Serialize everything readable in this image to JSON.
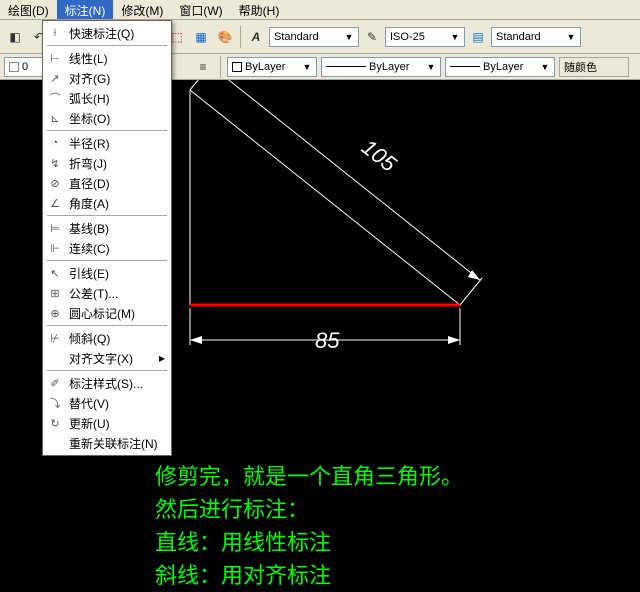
{
  "menu": {
    "draw": "绘图(D)",
    "dim": "标注(N)",
    "modify": "修改(M)",
    "window": "窗口(W)",
    "help": "帮助(H)"
  },
  "styles": {
    "text": "Standard",
    "dim": "ISO-25",
    "table": "Standard"
  },
  "layer": {
    "name": "0",
    "linetype": "ByLayer",
    "lineweight": "ByLayer",
    "plotstyle": "ByLayer",
    "color": "随颜色"
  },
  "dimmenu": {
    "quick": "快速标注(Q)",
    "linear": "线性(L)",
    "aligned": "对齐(G)",
    "arc": "弧长(H)",
    "ordinate": "坐标(O)",
    "radius": "半径(R)",
    "jogged": "折弯(J)",
    "diameter": "直径(D)",
    "angular": "角度(A)",
    "baseline": "基线(B)",
    "continue": "连续(C)",
    "leader": "引线(E)",
    "tolerance": "公差(T)...",
    "center": "圆心标记(M)",
    "oblique": "倾斜(Q)",
    "alignText": "对齐文字(X)",
    "style": "标注样式(S)...",
    "override": "替代(V)",
    "update": "更新(U)",
    "reassoc": "重新关联标注(N)"
  },
  "dims": {
    "hyp": "105",
    "base": "85"
  },
  "annot": {
    "l1": "修剪完，就是一个直角三角形。",
    "l2": "然后进行标注：",
    "l3": "直线：用线性标注",
    "l4": "斜线：用对齐标注"
  },
  "chart_data": {
    "type": "diagram",
    "shape": "right-triangle",
    "base_length": 85,
    "hypotenuse_length": 105,
    "base_dimension_label": "85",
    "hypotenuse_dimension_label": "105"
  }
}
